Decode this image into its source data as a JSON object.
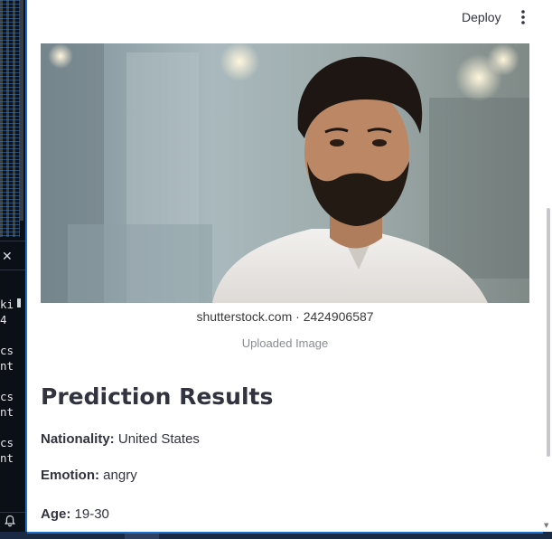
{
  "header": {
    "deploy_label": "Deploy",
    "menu_icon": "kebab-menu-icon"
  },
  "terminal": {
    "lines": [
      "ki",
      "4",
      "",
      "cs",
      "nt",
      "",
      "cs",
      "nt",
      "",
      "cs",
      "nt"
    ],
    "close_icon": "close-icon",
    "bell_icon": "bell-icon"
  },
  "image": {
    "watermark": "shutterstock.com · 2424906587",
    "caption": "Uploaded Image"
  },
  "results": {
    "title": "Prediction Results",
    "nationality_label": "Nationality:",
    "nationality_value": "United States",
    "emotion_label": "Emotion:",
    "emotion_value": "angry",
    "age_label": "Age:",
    "age_value": "19-30"
  },
  "colors": {
    "accent": "#1f6fd1",
    "text": "#31333f",
    "caption": "#8a8c95",
    "editor_bg": "#0b0f16"
  }
}
